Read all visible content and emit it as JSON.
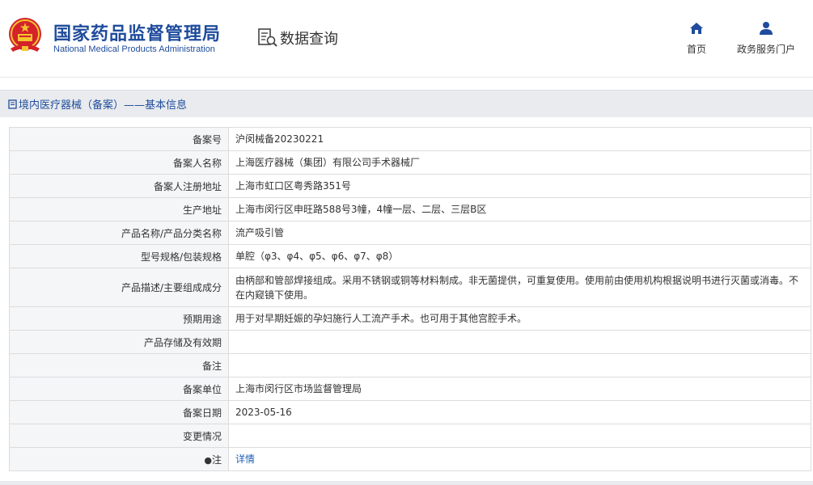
{
  "header": {
    "brand_cn": "国家药品监督管理局",
    "brand_en": "National Medical Products Administration",
    "query_label": "数据查询",
    "nav": [
      {
        "label": "首页",
        "icon": "home-icon"
      },
      {
        "label": "政务服务门户",
        "icon": "user-icon"
      }
    ]
  },
  "section": {
    "title": "境内医疗器械（备案）——基本信息",
    "icon": "document-icon"
  },
  "table": {
    "rows": [
      {
        "label": "备案号",
        "value": "沪闵械备20230221"
      },
      {
        "label": "备案人名称",
        "value": "上海医疗器械（集团）有限公司手术器械厂"
      },
      {
        "label": "备案人注册地址",
        "value": "上海市虹口区粤秀路351号"
      },
      {
        "label": "生产地址",
        "value": "上海市闵行区申旺路588号3幢，4幢一层、二层、三层B区"
      },
      {
        "label": "产品名称/产品分类名称",
        "value": "流产吸引管"
      },
      {
        "label": "型号规格/包装规格",
        "value": "单腔（φ3、φ4、φ5、φ6、φ7、φ8）"
      },
      {
        "label": "产品描述/主要组成成分",
        "value": "由柄部和管部焊接组成。采用不锈钢或铜等材料制成。非无菌提供，可重复使用。使用前由使用机构根据说明书进行灭菌或消毒。不在内窥镜下使用。"
      },
      {
        "label": "预期用途",
        "value": "用于对早期妊娠的孕妇施行人工流产手术。也可用于其他宫腔手术。"
      },
      {
        "label": "产品存储及有效期",
        "value": ""
      },
      {
        "label": "备注",
        "value": ""
      },
      {
        "label": "备案单位",
        "value": "上海市闵行区市场监督管理局"
      },
      {
        "label": "备案日期",
        "value": "2023-05-16"
      },
      {
        "label": "变更情况",
        "value": ""
      },
      {
        "label": "注",
        "value": "详情"
      }
    ]
  },
  "colors": {
    "brand_blue": "#1f4c9c",
    "link_blue": "#1f62b8",
    "label_bg": "#f5f6f8",
    "section_bg": "#e9ebee"
  }
}
